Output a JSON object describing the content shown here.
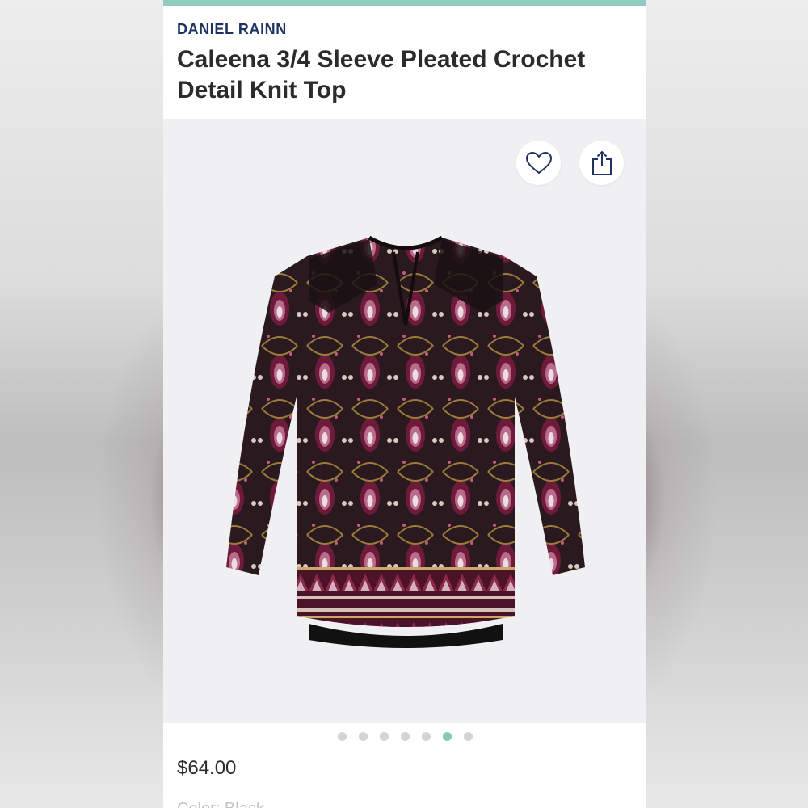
{
  "product": {
    "brand": "DANIEL RAINN",
    "title": "Caleena 3/4 Sleeve Pleated Crochet Detail Knit Top",
    "price": "$64.00",
    "color_label": "Color: Black"
  },
  "gallery": {
    "image_count": 7,
    "active_index": 5,
    "icons": {
      "favorite": "heart-icon",
      "share": "share-icon"
    }
  },
  "colors": {
    "brand": "#1d3163",
    "accent": "#8fcdc1",
    "active_dot": "#84c7bb",
    "inactive_dot": "#d4d4d4"
  }
}
